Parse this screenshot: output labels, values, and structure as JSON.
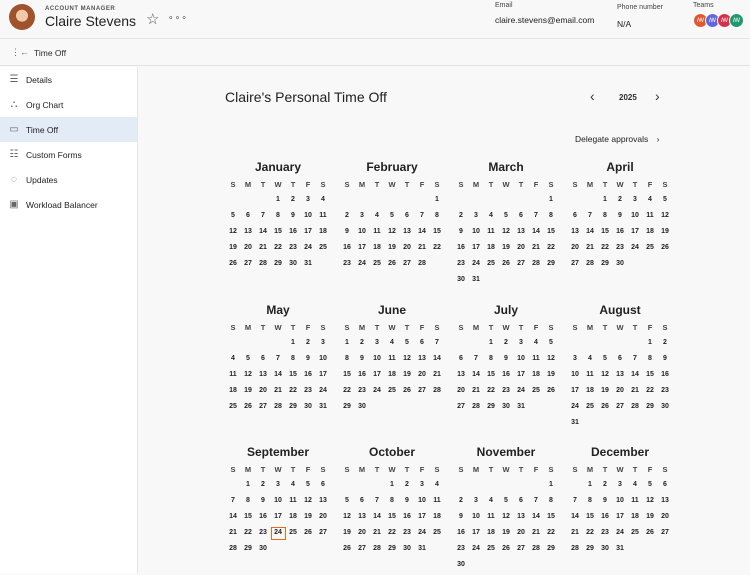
{
  "header": {
    "role": "ACCOUNT MANAGER",
    "name": "Claire Stevens",
    "email_label": "Email",
    "email": "claire.stevens@email.com",
    "phone_label": "Phone number",
    "phone": "N/A",
    "teams_label": "Teams",
    "teams": [
      {
        "initials": "ꟿ",
        "color": "#e4572e"
      },
      {
        "initials": "ꟿ",
        "color": "#6466e0"
      },
      {
        "initials": "ꟿ",
        "color": "#d9304a"
      },
      {
        "initials": "ꟿ",
        "color": "#1f9a6e"
      }
    ]
  },
  "subbar": {
    "label": "Time Off"
  },
  "sidebar": {
    "items": [
      {
        "label": "Details",
        "icon": "document-icon"
      },
      {
        "label": "Org Chart",
        "icon": "org-chart-icon"
      },
      {
        "label": "Time Off",
        "icon": "calendar-icon",
        "active": true
      },
      {
        "label": "Custom Forms",
        "icon": "forms-icon"
      },
      {
        "label": "Updates",
        "icon": "chat-icon"
      },
      {
        "label": "Workload Balancer",
        "icon": "workload-icon"
      }
    ]
  },
  "main": {
    "title": "Claire's Personal Time Off",
    "year": "2025",
    "delegate": "Delegate approvals"
  },
  "calendar": {
    "weekdays": [
      "S",
      "M",
      "T",
      "W",
      "T",
      "F",
      "S"
    ],
    "highlight": {
      "month": 8,
      "day": 24,
      "color": "#e86a1f"
    },
    "months": [
      {
        "name": "January",
        "start": 3,
        "days": 31
      },
      {
        "name": "February",
        "start": 6,
        "days": 28
      },
      {
        "name": "March",
        "start": 6,
        "days": 31
      },
      {
        "name": "April",
        "start": 2,
        "days": 30
      },
      {
        "name": "May",
        "start": 4,
        "days": 31
      },
      {
        "name": "June",
        "start": 0,
        "days": 30
      },
      {
        "name": "July",
        "start": 2,
        "days": 31
      },
      {
        "name": "August",
        "start": 5,
        "days": 31
      },
      {
        "name": "September",
        "start": 1,
        "days": 30
      },
      {
        "name": "October",
        "start": 3,
        "days": 31
      },
      {
        "name": "November",
        "start": 6,
        "days": 30
      },
      {
        "name": "December",
        "start": 1,
        "days": 31
      }
    ]
  }
}
